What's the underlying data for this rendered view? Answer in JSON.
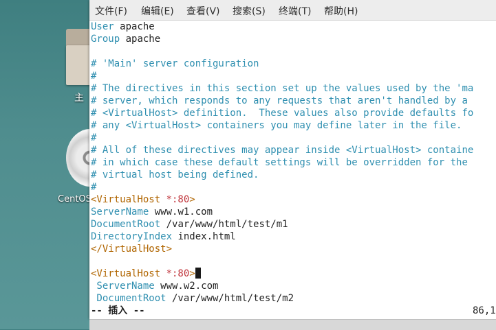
{
  "desktop": {
    "folder_label": "主",
    "disc_label": "CentOS"
  },
  "menu": {
    "file": "文件(F)",
    "edit": "编辑(E)",
    "view": "查看(V)",
    "search": "搜索(S)",
    "terminal": "终端(T)",
    "help": "帮助(H)"
  },
  "editor": {
    "user_key": "User",
    "user_val": " apache",
    "group_key": "Group",
    "group_val": " apache",
    "c1": "# 'Main' server configuration",
    "c2": "#",
    "c3": "# The directives in this section set up the values used by the 'ma",
    "c4": "# server, which responds to any requests that aren't handled by a",
    "c5": "# <VirtualHost> definition.  These values also provide defaults fo",
    "c6": "# any <VirtualHost> containers you may define later in the file.",
    "c7": "#",
    "c8": "# All of these directives may appear inside <VirtualHost> containe",
    "c9": "# in which case these default settings will be overridden for the",
    "c10": "# virtual host being defined.",
    "c11": "#",
    "vh1_open": "<VirtualHost ",
    "vh_port": "*:80",
    "vh_close_bracket": ">",
    "sn1_key": "ServerName",
    "sn1_val": " www.w1.com",
    "dr1_key": "DocumentRoot",
    "dr1_val": " /var/www/html/test/m1",
    "di1_key": "DirectoryIndex",
    "di1_val": " index.html",
    "vh1_end": "</VirtualHost>",
    "sn2_key": " ServerName",
    "sn2_val": " www.w2.com",
    "dr2_key": " DocumentRoot",
    "dr2_val": " /var/www/html/test/m2"
  },
  "status": {
    "mode": "-- 插入 --",
    "position": "86,1"
  },
  "colors": {
    "keyword": "#2f8fb0",
    "tag": "#b06500",
    "value": "#c0353c"
  }
}
